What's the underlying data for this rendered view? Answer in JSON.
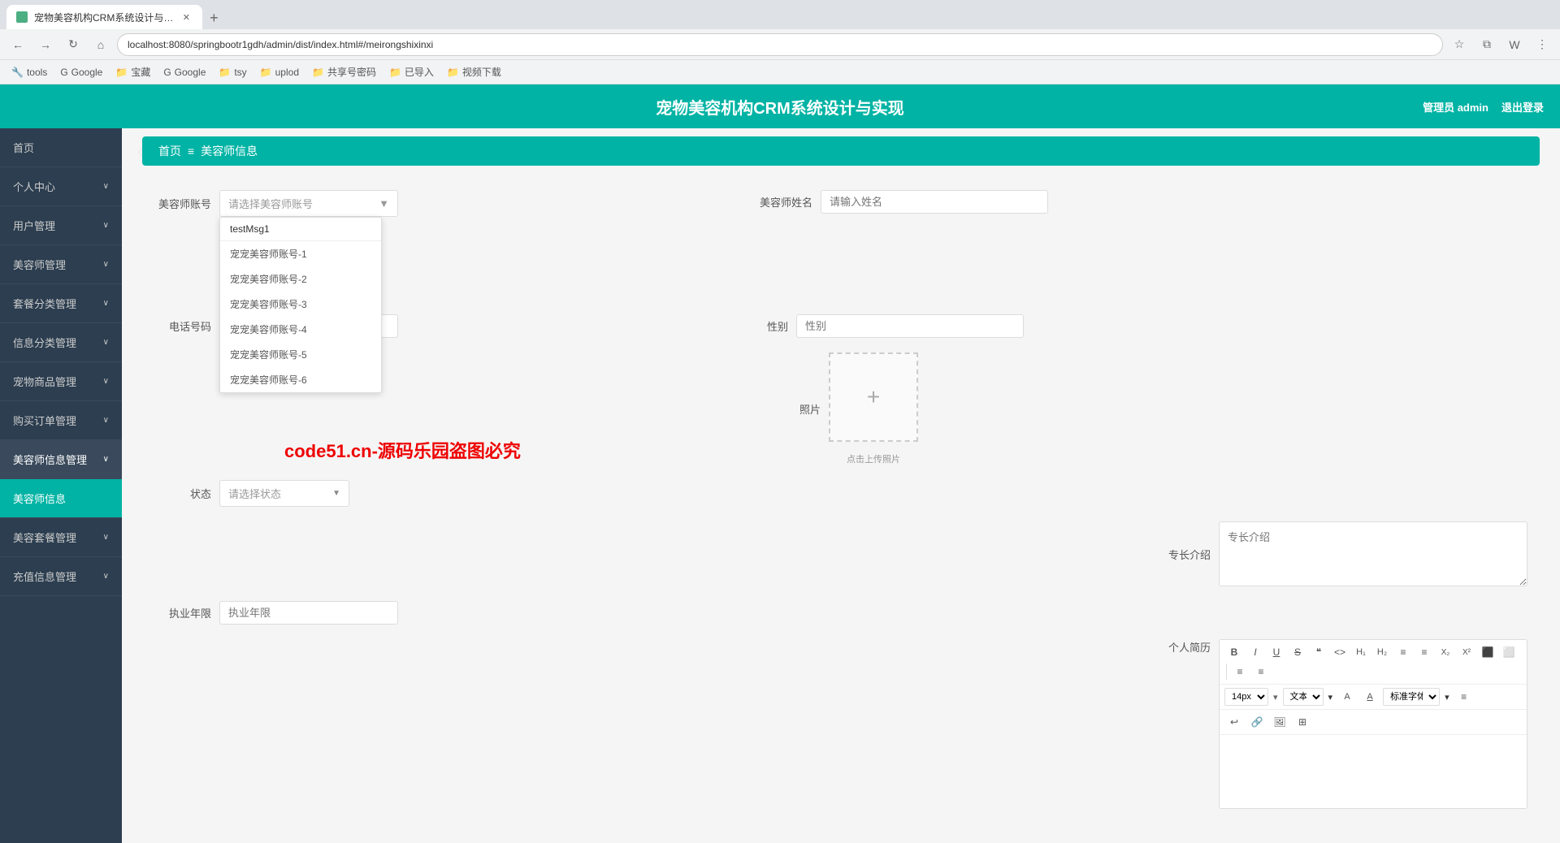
{
  "browser": {
    "tab_title": "宠物美容机构CRM系统设计与…",
    "url": "localhost:8080/springbootr1gdh/admin/dist/index.html#/meirongshixinxi",
    "new_tab_label": "+",
    "bookmarks": [
      "tools",
      "Google",
      "宝藏",
      "Google",
      "tsy",
      "uplod",
      "共享号密码",
      "已导入",
      "视频下载"
    ]
  },
  "app": {
    "title": "宠物美容机构CRM系统设计与实现",
    "admin_text": "管理员 admin",
    "logout_text": "退出登录"
  },
  "sidebar": {
    "items": [
      {
        "label": "首页",
        "arrow": false,
        "active": false
      },
      {
        "label": "个人中心",
        "arrow": true,
        "active": false
      },
      {
        "label": "用户管理",
        "arrow": true,
        "active": false
      },
      {
        "label": "美容师管理",
        "arrow": true,
        "active": false
      },
      {
        "label": "套餐分类管理",
        "arrow": true,
        "active": false
      },
      {
        "label": "信息分类管理",
        "arrow": true,
        "active": false
      },
      {
        "label": "宠物商品管理",
        "arrow": true,
        "active": false
      },
      {
        "label": "购买订单管理",
        "arrow": true,
        "active": false
      },
      {
        "label": "美容师信息管理",
        "arrow": true,
        "active": true
      },
      {
        "label": "美容师信息",
        "arrow": false,
        "active": true
      },
      {
        "label": "美容套餐管理",
        "arrow": true,
        "active": false
      },
      {
        "label": "充值信息管理",
        "arrow": true,
        "active": false
      }
    ]
  },
  "breadcrumb": {
    "home": "首页",
    "separator": "≡",
    "current": "美容师信息"
  },
  "form": {
    "fields": {
      "staff_id_label": "美容师账号",
      "staff_id_placeholder": "请选择美容师账号",
      "staff_name_label": "美容师姓名",
      "staff_name_placeholder": "请输入姓名",
      "phone_label": "电话号码",
      "phone_placeholder": "",
      "gender_label": "性别",
      "gender_placeholder": "性别",
      "photo_label": "照片",
      "photo_hint": "点击上传照片",
      "status_label": "状态",
      "status_placeholder": "请选择状态",
      "specialty_label": "专长介绍",
      "specialty_placeholder": "专长介绍",
      "years_label": "执业年限",
      "years_placeholder": "执业年限",
      "bio_label": "个人简历"
    },
    "dropdown": {
      "first_item": "testMsg1",
      "items": [
        "宠宠美容师账号-1",
        "宠宠美容师账号-2",
        "宠宠美容师账号-3",
        "宠宠美容师账号-4",
        "宠宠美容师账号-5",
        "宠宠美容师账号-6"
      ]
    },
    "toolbar": {
      "buttons": [
        "B",
        "I",
        "U",
        "S",
        "❝",
        "<>",
        "H₁",
        "H₂",
        "≡",
        "≡",
        "X₂",
        "X²",
        "⬛",
        "⬜"
      ],
      "font_size": "14px",
      "font_size_label": "文本",
      "font_family": "标准字体"
    }
  },
  "watermark": {
    "text": "code51.cn",
    "red_text": "code51.cn-源码乐园盗图必究"
  }
}
